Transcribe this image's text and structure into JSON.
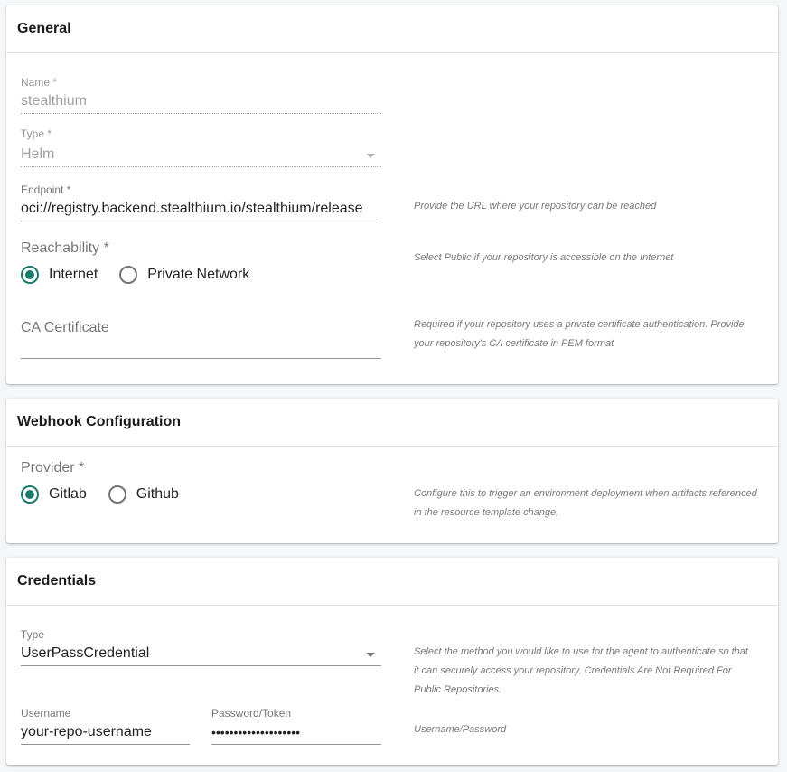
{
  "colors": {
    "accent": "#1b7a6e"
  },
  "general": {
    "title": "General",
    "name_label": "Name *",
    "name_value": "stealthium",
    "type_label": "Type *",
    "type_value": "Helm",
    "endpoint_label": "Endpoint *",
    "endpoint_value": "oci://registry.backend.stealthium.io/stealthium/release",
    "endpoint_help": "Provide the URL where your repository can be reached",
    "reachability_label": "Reachability *",
    "reachability_options": [
      "Internet",
      "Private Network"
    ],
    "reachability_selected": "Internet",
    "reachability_help": "Select Public if your repository is accessible on the Internet",
    "ca_label": "CA Certificate",
    "ca_help_line1": "Required if your repository uses a private certificate authentication. Provide",
    "ca_help_line2": "your repository's CA certificate in PEM format"
  },
  "webhook": {
    "title": "Webhook Configuration",
    "provider_label": "Provider *",
    "provider_options": [
      "Gitlab",
      "Github"
    ],
    "provider_selected": "Gitlab",
    "help_line1": "Configure this to trigger an environment deployment when artifacts referenced",
    "help_line2": "in the resource template change."
  },
  "credentials": {
    "title": "Credentials",
    "type_label": "Type",
    "type_value": "UserPassCredential",
    "type_help_line1": "Select the method you would like to use for the agent to authenticate so that",
    "type_help_line2": "it can securely access your repository. Credentials Are Not Required For",
    "type_help_line3": "Public Repositories.",
    "username_label": "Username",
    "username_value": "your-repo-username",
    "password_label": "Password/Token",
    "password_value": "••••••••••••••••••••",
    "userpass_help": "Username/Password"
  }
}
